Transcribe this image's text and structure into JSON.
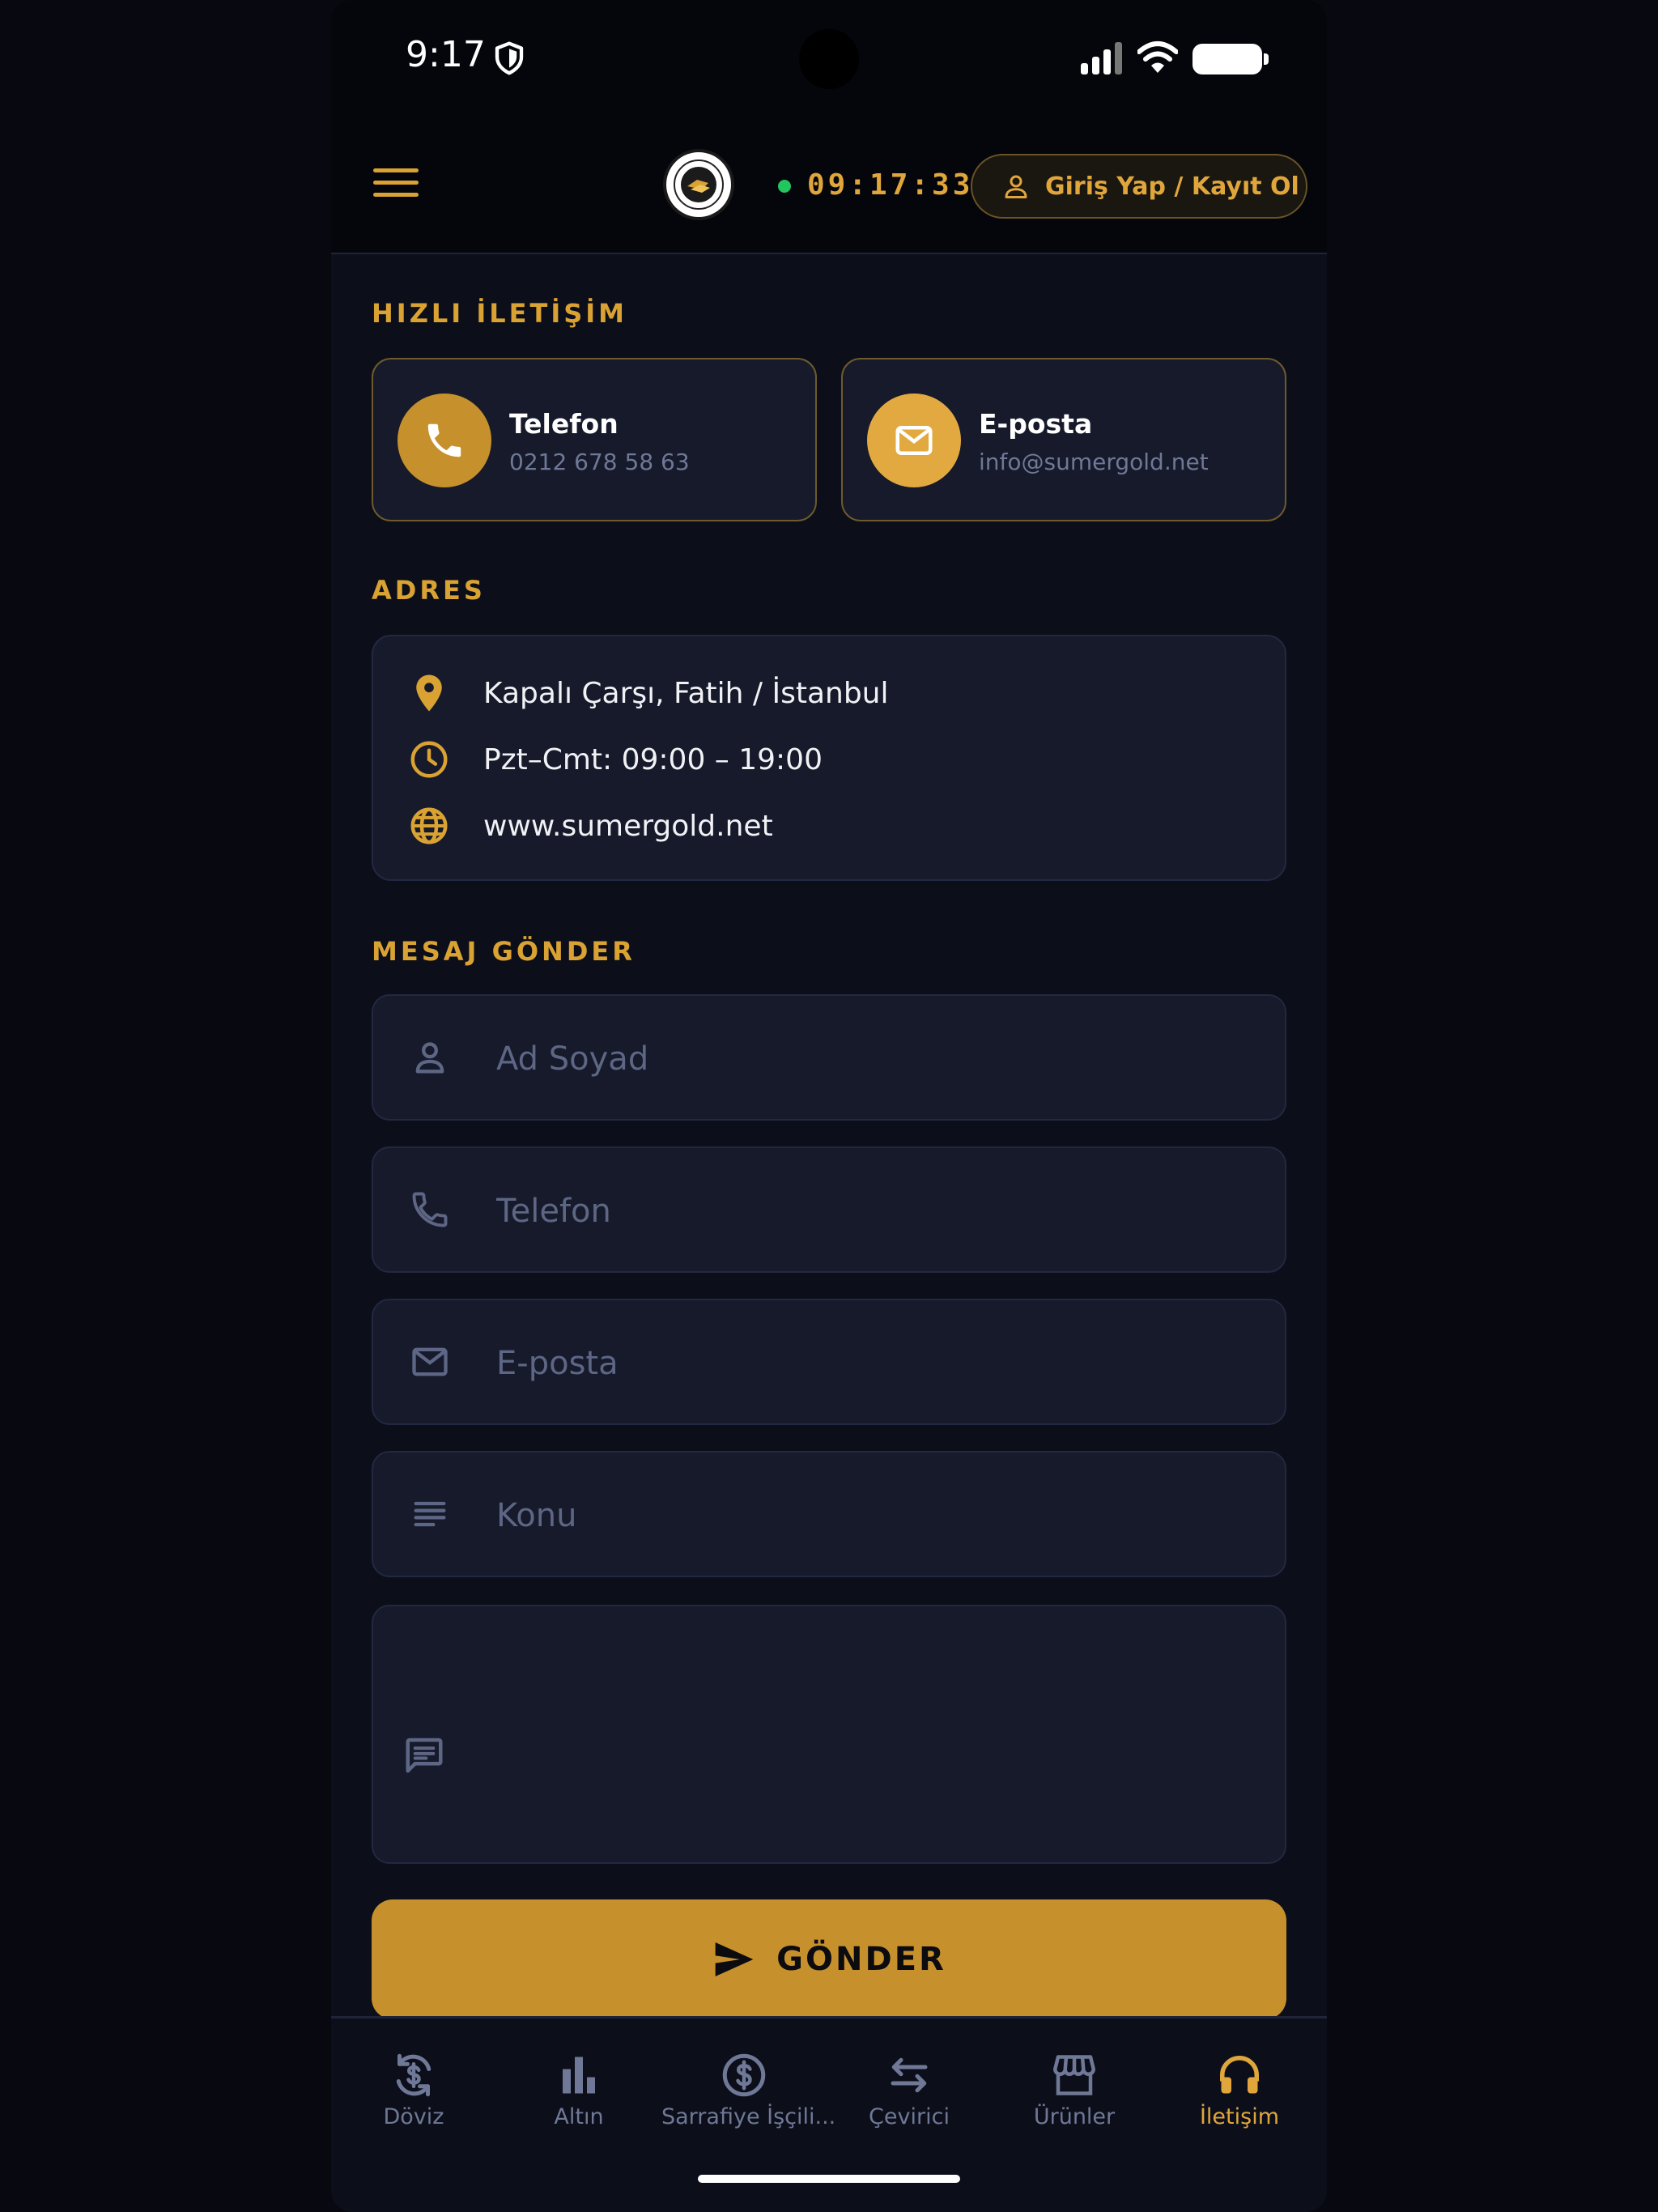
{
  "status_bar": {
    "time": "9:17"
  },
  "header": {
    "clock": "09:17:33",
    "login_label": "Giriş Yap / Kayıt Ol"
  },
  "quick_contact": {
    "section_title": "HIZLI İLETİŞİM",
    "phone": {
      "title": "Telefon",
      "value": "0212 678 58 63"
    },
    "email": {
      "title": "E-posta",
      "value": "info@sumergold.net"
    }
  },
  "address": {
    "section_title": "ADRES",
    "location": "Kapalı Çarşı, Fatih / İstanbul",
    "hours": "Pzt–Cmt: 09:00 – 19:00",
    "website": "www.sumergold.net"
  },
  "message_form": {
    "section_title": "MESAJ GÖNDER",
    "name_placeholder": "Ad Soyad",
    "phone_placeholder": "Telefon",
    "email_placeholder": "E-posta",
    "subject_placeholder": "Konu",
    "message_placeholder": "",
    "send_label": "GÖNDER"
  },
  "bottom_nav": {
    "items": [
      {
        "label": "Döviz",
        "icon": "currency-exchange-icon"
      },
      {
        "label": "Altın",
        "icon": "bar-chart-icon"
      },
      {
        "label": "Sarrafiye İşçili...",
        "icon": "dollar-circle-icon"
      },
      {
        "label": "Çevirici",
        "icon": "swap-arrows-icon"
      },
      {
        "label": "Ürünler",
        "icon": "store-icon"
      },
      {
        "label": "İletişim",
        "icon": "headset-icon"
      }
    ],
    "active_index": 5
  },
  "colors": {
    "accent": "#d9a233",
    "button": "#c6912c",
    "background": "#0c0f1a",
    "card": "#161a2a",
    "live": "#22c55e"
  }
}
